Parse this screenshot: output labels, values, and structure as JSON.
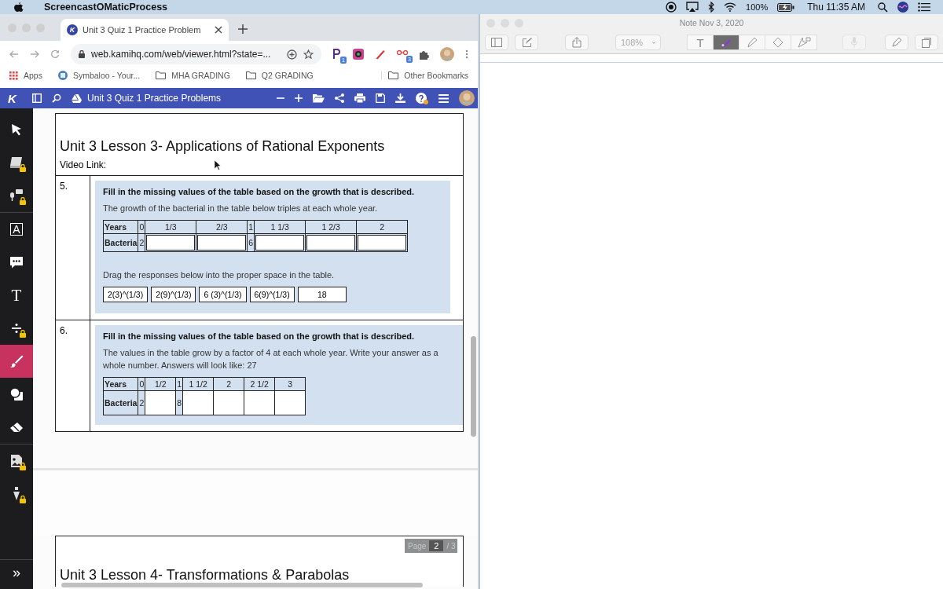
{
  "menubar": {
    "app_name": "ScreencastOMaticProcess",
    "battery": "100%",
    "clock": "Thu 11:35 AM"
  },
  "browser": {
    "tab": {
      "favicon": "K",
      "title": "Unit 3 Quiz 1 Practice Problem"
    },
    "url": "web.kamihq.com/web/viewer.html?state=...",
    "extension_badges": [
      "1",
      "3"
    ],
    "bookmarks": [
      {
        "kind": "apps",
        "label": "Apps"
      },
      {
        "kind": "site",
        "label": "Symbaloo - Your..."
      },
      {
        "kind": "folder",
        "label": "MHA GRADING"
      },
      {
        "kind": "folder",
        "label": "Q2 GRADING"
      }
    ],
    "other_bookmarks": "Other Bookmarks"
  },
  "kami": {
    "logo": "K",
    "doc_title": "Unit 3 Quiz 1 Practice Problems",
    "tools": [
      {
        "kind": "pointer",
        "selected": false,
        "locked": false
      },
      {
        "kind": "book",
        "selected": false,
        "locked": true
      },
      {
        "kind": "voice",
        "selected": false,
        "locked": true
      },
      {
        "kind": "textbox",
        "glyph": "A",
        "selected": false,
        "locked": false
      },
      {
        "kind": "comment",
        "selected": false,
        "locked": false
      },
      {
        "kind": "text",
        "glyph": "T",
        "selected": false,
        "locked": false
      },
      {
        "kind": "divide",
        "selected": false,
        "locked": true
      },
      {
        "kind": "brush",
        "selected": true,
        "locked": false
      },
      {
        "kind": "shapes",
        "selected": false,
        "locked": false
      },
      {
        "kind": "eraser",
        "selected": false,
        "locked": false
      },
      {
        "kind": "image",
        "selected": false,
        "locked": true
      },
      {
        "kind": "pen",
        "selected": false,
        "locked": true
      }
    ],
    "expand": "»"
  },
  "document": {
    "heading": "Unit 3 Lesson 3- Applications of Rational Exponents",
    "video_link": "Video Link:",
    "questions": [
      {
        "number": "5.",
        "prompt": "Fill in the missing values of the table based on the growth that is described.",
        "description": "The growth of the bacterial in the table below triples at each whole year.",
        "rows": [
          {
            "header": "Years",
            "cells": [
              {
                "kind": "given",
                "value": "0"
              },
              {
                "kind": "given",
                "value": "1/3"
              },
              {
                "kind": "given",
                "value": "2/3"
              },
              {
                "kind": "given",
                "value": "1"
              },
              {
                "kind": "given",
                "value": "1 1/3"
              },
              {
                "kind": "given",
                "value": "1 2/3"
              },
              {
                "kind": "given",
                "value": "2"
              }
            ]
          },
          {
            "header": "Bacteria",
            "cells": [
              {
                "kind": "given",
                "value": "2"
              },
              {
                "kind": "input"
              },
              {
                "kind": "input"
              },
              {
                "kind": "given",
                "value": "6"
              },
              {
                "kind": "input"
              },
              {
                "kind": "input"
              },
              {
                "kind": "input"
              }
            ]
          }
        ],
        "drag_label": "Drag the responses below into the proper space in the table.",
        "responses": [
          "2(3)^(1/3)",
          "2(9)^(1/3)",
          "6 (3)^(1/3)",
          "6(9)^(1/3)",
          "18"
        ]
      },
      {
        "number": "6.",
        "prompt": "Fill in the missing values of the table based on the growth that is described.",
        "description": "The values in the table grow by a factor of 4 at each whole year. Write your answer as a whole number. Answers will look like: 27",
        "rows": [
          {
            "header": "Years",
            "cells": [
              {
                "kind": "given",
                "value": "0"
              },
              {
                "kind": "given",
                "value": "1/2"
              },
              {
                "kind": "given",
                "value": "1"
              },
              {
                "kind": "given",
                "value": "1 1/2"
              },
              {
                "kind": "given",
                "value": "2"
              },
              {
                "kind": "given",
                "value": "2 1/2"
              },
              {
                "kind": "given",
                "value": "3"
              }
            ]
          },
          {
            "header": "Bacteria",
            "cells": [
              {
                "kind": "given",
                "value": "2"
              },
              {
                "kind": "blank"
              },
              {
                "kind": "given",
                "value": "8"
              },
              {
                "kind": "blank"
              },
              {
                "kind": "blank"
              },
              {
                "kind": "blank"
              },
              {
                "kind": "blank"
              }
            ]
          }
        ]
      }
    ],
    "next_heading": "Unit 3 Lesson 4- Transformations & Parabolas",
    "page_indicator": {
      "label": "Page",
      "current": "2",
      "total": "/ 3"
    }
  },
  "notes": {
    "title": "Note Nov 3, 2020",
    "zoom": "108%",
    "text_tool": "T",
    "tools": [
      {
        "kind": "marker",
        "selected": true
      },
      {
        "kind": "highlighter",
        "selected": false
      },
      {
        "kind": "eraser",
        "selected": false
      },
      {
        "kind": "lasso",
        "selected": false
      }
    ]
  }
}
